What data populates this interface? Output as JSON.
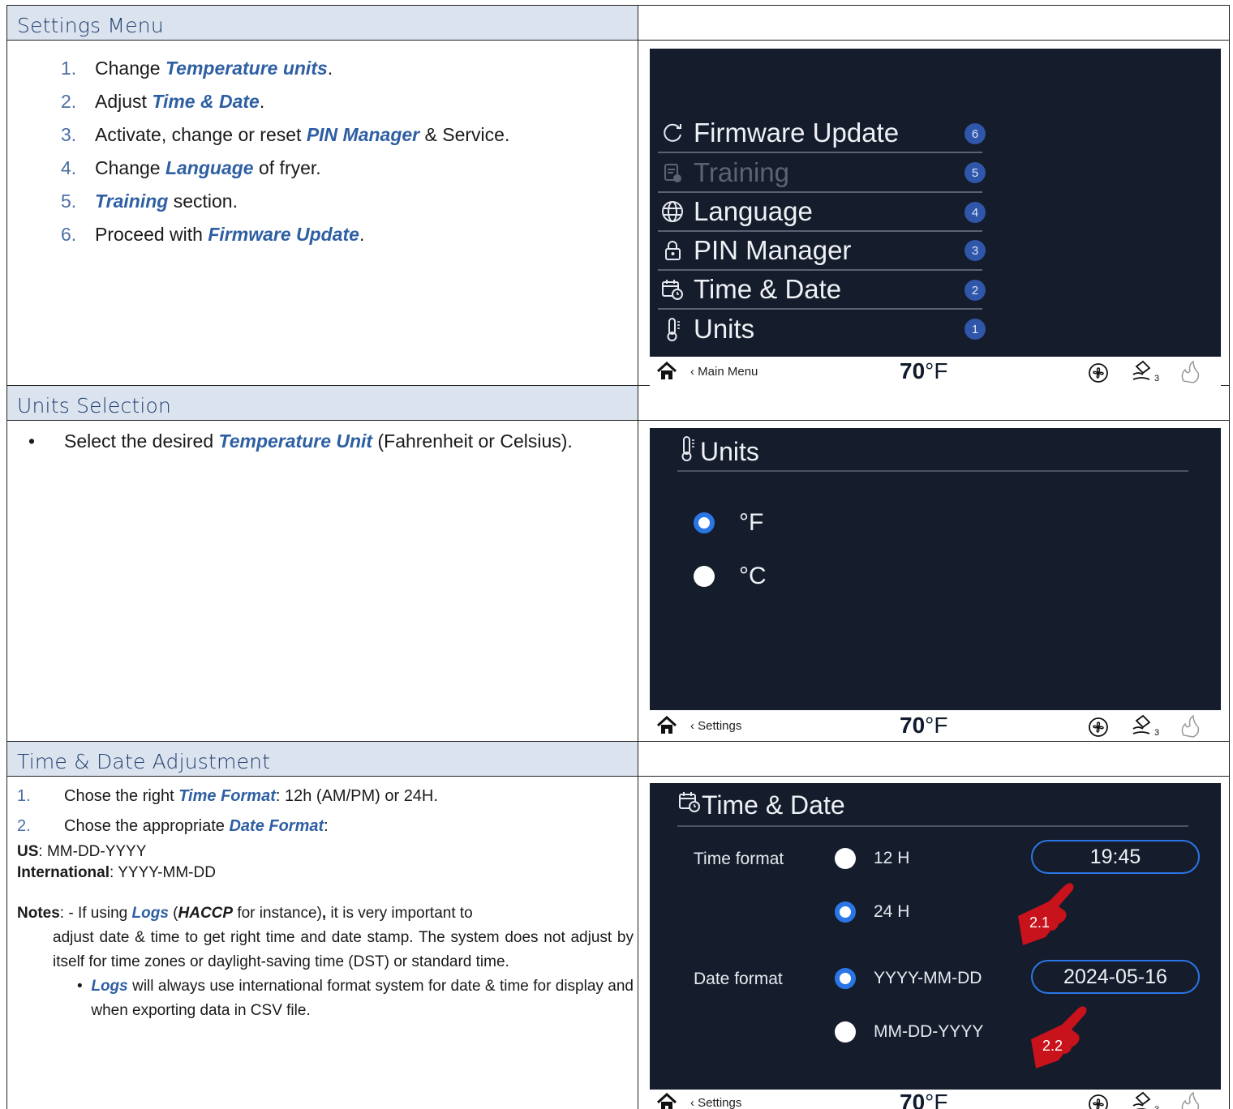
{
  "sections": [
    {
      "title": "Settings Menu",
      "steps": [
        {
          "num": "1.",
          "pre": "Change ",
          "em": "Temperature units",
          "post": "."
        },
        {
          "num": "2.",
          "pre": "Adjust ",
          "em": "Time & Date",
          "post": "."
        },
        {
          "num": "3.",
          "pre": "Activate, change or reset ",
          "em": "PIN Manager",
          "post": " & Service."
        },
        {
          "num": "4.",
          "pre": "Change ",
          "em": "Language",
          "post": " of fryer."
        },
        {
          "num": "5.",
          "pre": "",
          "em": "Training",
          "post": " section."
        },
        {
          "num": "6.",
          "pre": "Proceed with ",
          "em": "Firmware Update",
          "post": "."
        }
      ],
      "screen": {
        "menu": [
          {
            "label": "Firmware Update",
            "badge": "6",
            "icon": "refresh-icon",
            "dim": false
          },
          {
            "label": "Training",
            "badge": "5",
            "icon": "training-icon",
            "dim": true
          },
          {
            "label": "Language",
            "badge": "4",
            "icon": "globe-icon",
            "dim": false
          },
          {
            "label": "PIN Manager",
            "badge": "3",
            "icon": "lock-icon",
            "dim": false
          },
          {
            "label": "Time & Date",
            "badge": "2",
            "icon": "calendar-clock-icon",
            "dim": false
          },
          {
            "label": "Units",
            "badge": "1",
            "icon": "thermometer-icon",
            "dim": false
          }
        ],
        "back_label": "Main Menu"
      }
    },
    {
      "title": "Units Selection",
      "bullet": {
        "dot": "•",
        "pre": "Select the desired ",
        "em": "Temperature Unit",
        "post": " (Fahrenheit or Celsius)."
      },
      "screen": {
        "title": "Units",
        "options": [
          {
            "label": "°F",
            "selected": true
          },
          {
            "label": "°C",
            "selected": false
          }
        ],
        "back_label": "Settings"
      }
    },
    {
      "title": "Time & Date Adjustment",
      "steps": [
        {
          "num": "1.",
          "pre": "Chose the right ",
          "em": "Time Format",
          "post": ": 12h (AM/PM) or 24H."
        },
        {
          "num": "2.",
          "pre": "Chose the appropriate ",
          "em": "Date Format",
          "post": ":"
        }
      ],
      "formats": [
        {
          "label": "US",
          "value": ": MM-DD-YYYY"
        },
        {
          "label": "International",
          "value": ": YYYY-MM-DD"
        }
      ],
      "notes": {
        "label": "Notes",
        "intro": ": - If using ",
        "logs": "Logs",
        "paren_open": " (",
        "haccp": "HACCP",
        "mid": " for instance)",
        "comma": ",",
        "rest_first": " it is very important to",
        "rest": "adjust date & time to get right time and date stamp. The system does not adjust by itself for time zones or daylight-saving time (DST) or standard time.",
        "sub_bullet": "•",
        "sub_logs": "Logs",
        "sub_rest": " will always use international format system for date & time for display and when exporting data in CSV file."
      },
      "screen": {
        "title": "Time & Date",
        "time_format_label": "Time format",
        "date_format_label": "Date format",
        "time_options": [
          {
            "label": "12 H",
            "selected": false
          },
          {
            "label": "24 H",
            "selected": true
          }
        ],
        "date_options": [
          {
            "label": "YYYY-MM-DD",
            "selected": true
          },
          {
            "label": "MM-DD-YYYY",
            "selected": false
          }
        ],
        "time_value": "19:45",
        "date_value": "2024-05-16",
        "callouts": [
          "2.1",
          "2.2"
        ],
        "back_label": "Settings"
      }
    }
  ],
  "status_bar": {
    "temp_value": "70",
    "temp_unit": "°F",
    "oil_count": "3",
    "back_chevron": "‹"
  }
}
